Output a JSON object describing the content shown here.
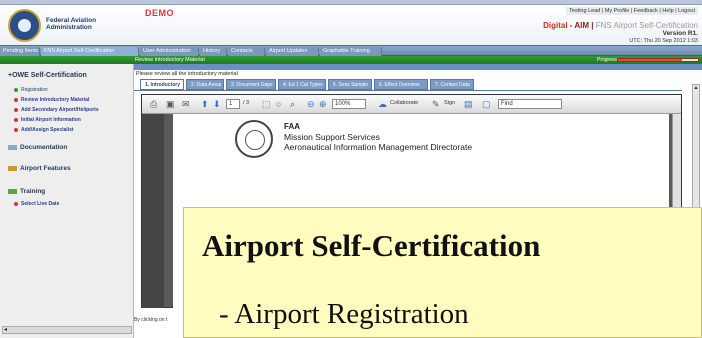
{
  "header": {
    "agency_name": "Federal Aviation Administration",
    "environment": "DEMO",
    "top_links": "Testing Lead | My Profile | Feedback | Help | Logout",
    "app_title_digital": "Digital",
    "app_title_aim": "- AIM |",
    "app_title_rest": "FNS Airport Self-Certification",
    "version": "Version R1.",
    "utc": "UTC: Thu 20 Sep 2012 1:03"
  },
  "nav": {
    "tabs": [
      "Pending Items",
      "FNS Airport Self-Certification",
      "User Administration",
      "History",
      "Contacts",
      "Airport Updates",
      "Graphable Training"
    ],
    "active_index": 1
  },
  "progress": {
    "breadcrumb": "Review Introductory Material",
    "label": "Progress",
    "fraction": 0.8
  },
  "sidebar": {
    "title": "+OWE Self-Certification",
    "items": [
      "Registration",
      "Review Introductory Material",
      "Add Secondary Airport/Heliports",
      "Initial Airport Information",
      "Add/Assign Specialist"
    ],
    "sections": [
      "Documentation",
      "Airport Features",
      "Training"
    ],
    "training_item": "Select Live Date"
  },
  "main": {
    "instruction": "Please review all the introductory material",
    "subtabs": [
      "1. Introductory",
      "2. Data Areas",
      "3. Document Gaps",
      "4. Ed 1 Cat Types",
      "5. Sess Sample",
      "6. Effect Overview",
      "7. Contact Data"
    ],
    "active_subtab": 0,
    "bottom_text": "By clicking on t"
  },
  "pdf_viewer": {
    "page_value": "1",
    "page_total": "/ 3",
    "zoom": "100%",
    "collaborate": "Collaborate",
    "sign": "Sign",
    "find": "Find",
    "doc_line1": "FAA",
    "doc_line2": "Mission Support Services",
    "doc_line3": "Aeronautical Information Management Directorate"
  },
  "overlay": {
    "title": "Airport Self-Certification",
    "item": "- Airport Registration"
  },
  "colors": {
    "nav_blue": "#7c98bd",
    "progress_green": "#1e7a22",
    "progress_red": "#e4493e",
    "overlay_yellow": "#fffcc0",
    "demo_red": "#d23a3a"
  }
}
